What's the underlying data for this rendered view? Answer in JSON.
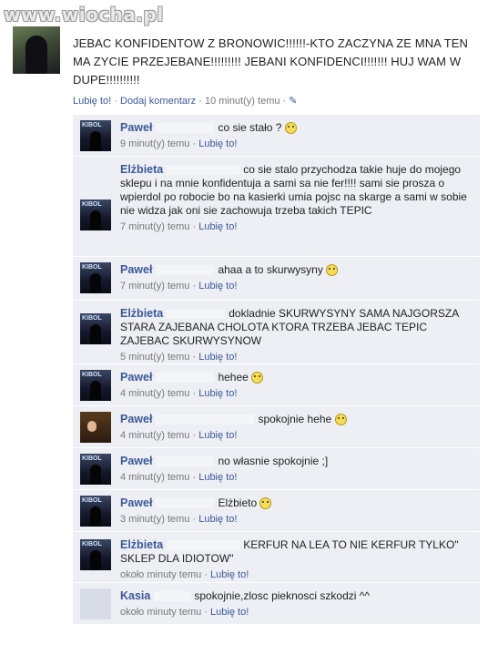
{
  "watermark": "www.wiocha.pl",
  "post": {
    "text": "JEBAC KONFIDENTOW Z BRONOWIC!!!!!!-KTO ZACZYNA ZE MNA TEN MA ZYCIE PRZEJEBANE!!!!!!!!! JEBANI KONFIDENCI!!!!!!! HUJ WAM W DUPE!!!!!!!!!!",
    "like": "Lubię to!",
    "comment": "Dodaj komentarz",
    "time": "10 minut(y) temu"
  },
  "comments": [
    {
      "name": "Paweł",
      "text": "co sie stało ?",
      "time": "9 minut(y) temu",
      "like": "Lubię to!",
      "smile": true
    },
    {
      "name": "Elżbieta",
      "text": "co sie stalo przychodza takie huje do mojego sklepu i na mnie konfidentuja a sami sa nie fer!!!! sami sie prosza o wpierdol po robocie bo na kasierki umia pojsc na skarge a sami w sobie nie widza jak oni sie zachowuja trzeba takich TEPIC",
      "time": "7 minut(y) temu",
      "like": "Lubię to!",
      "smile": false
    },
    {
      "name": "Paweł",
      "text": "ahaa a to skurwysyny",
      "time": "7 minut(y) temu",
      "like": "Lubię to!",
      "smile": true
    },
    {
      "name": "Elżbieta",
      "text": "dokladnie SKURWYSYNY SAMA NAJGORSZA STARA ZAJEBANA CHOLOTA KTORA TRZEBA JEBAC TEPIC ZAJEBAC SKURWYSYNOW",
      "time": "5 minut(y) temu",
      "like": "Lubię to!",
      "smile": false
    },
    {
      "name": "Paweł",
      "text": "hehee",
      "time": "4 minut(y) temu",
      "like": "Lubię to!",
      "smile": true
    },
    {
      "name": "Paweł",
      "text": "spokojnie hehe",
      "time": "4 minut(y) temu",
      "like": "Lubię to!",
      "smile": true
    },
    {
      "name": "Paweł",
      "text": "no własnie spokojnie ;]",
      "time": "4 minut(y) temu",
      "like": "Lubię to!",
      "smile": false
    },
    {
      "name": "Paweł",
      "text": "Elżbieto",
      "time": "3 minut(y) temu",
      "like": "Lubię to!",
      "smile": true
    },
    {
      "name": "Elżbieta",
      "text": "KERFUR NA LEA TO NIE KERFUR TYLKO\" SKLEP DLA IDIOTOW\"",
      "time": "około minuty temu",
      "like": "Lubię to!",
      "smile": false
    },
    {
      "name": "Kasia",
      "text": "spokojnie,zlosc pieknosci szkodzi ^^",
      "time": "około minuty temu",
      "like": "Lubię to!",
      "smile": false
    }
  ]
}
